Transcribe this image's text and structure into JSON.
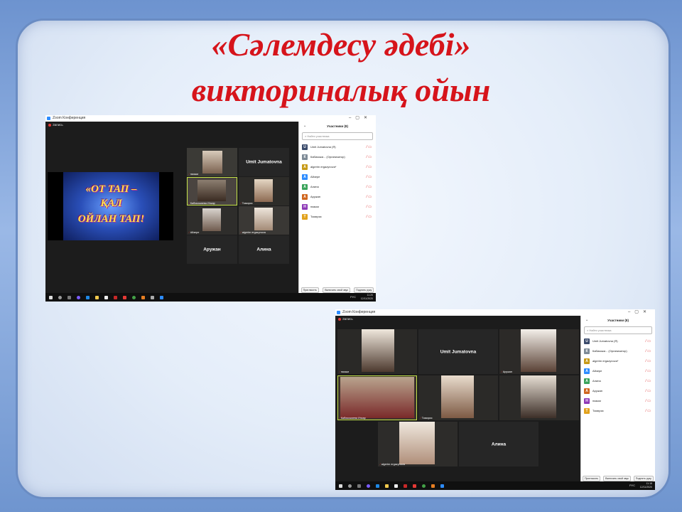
{
  "slide_title": {
    "line1": "«Сәлемдесу әдебі»",
    "line2": "викториналық ойын"
  },
  "zoom": {
    "app_title": "Zoom Конференция",
    "meeting_label": "Запись",
    "panel_title": "Участники (8)",
    "search_placeholder": "Найти участника",
    "participants": [
      {
        "initial": "U",
        "name": "Umit Jumatovna (Я)",
        "color": "#3a4a6b"
      },
      {
        "initial": "К",
        "name": "Кабикожи... (Организатор)",
        "color": "#7d8a96"
      },
      {
        "initial": "A",
        "name": "algerim ergazynova*",
        "color": "#c79a17"
      },
      {
        "initial": "А",
        "name": "Айзере",
        "color": "#2d8cff"
      },
      {
        "initial": "А",
        "name": "Алина",
        "color": "#3aa35a"
      },
      {
        "initial": "А",
        "name": "Аружан",
        "color": "#d0661e"
      },
      {
        "initial": "Н",
        "name": "назым",
        "color": "#8e3ab7"
      },
      {
        "initial": "Т",
        "name": "Томирис",
        "color": "#e2a21c"
      }
    ],
    "footer_buttons": [
      "Пригласить",
      "Включить свой звук",
      "Поднять руку"
    ],
    "taskbar_lang": "РУС",
    "w1_clock": {
      "time": "11:20",
      "date": "12/11/2020"
    },
    "w2_clock": {
      "time": "11:18",
      "date": "12/11/2020"
    }
  },
  "w1": {
    "shared_slide_lines": [
      "«ОТ ТАП –",
      "ҚАЛ",
      "ОЙЛАН ТАП!"
    ],
    "tiles": {
      "nazym": "назым",
      "umit": "Umit Jumatovna",
      "kabik": "Кабикожаева Инкар",
      "tomiris": "Томирис",
      "aizere": "Айзере",
      "algerim": "algerim ergazynova",
      "aruzhan": "Аружан",
      "alina": "Алина"
    }
  },
  "w2": {
    "tiles": {
      "nazym": "назым",
      "umit": "Umit Jumatovna",
      "aruzhan": "Аружан",
      "kabik": "Кабикожаева Инкар",
      "tomiris": "Томирис",
      "algerim": "algerim ergazynova",
      "alina": "Алина"
    }
  }
}
